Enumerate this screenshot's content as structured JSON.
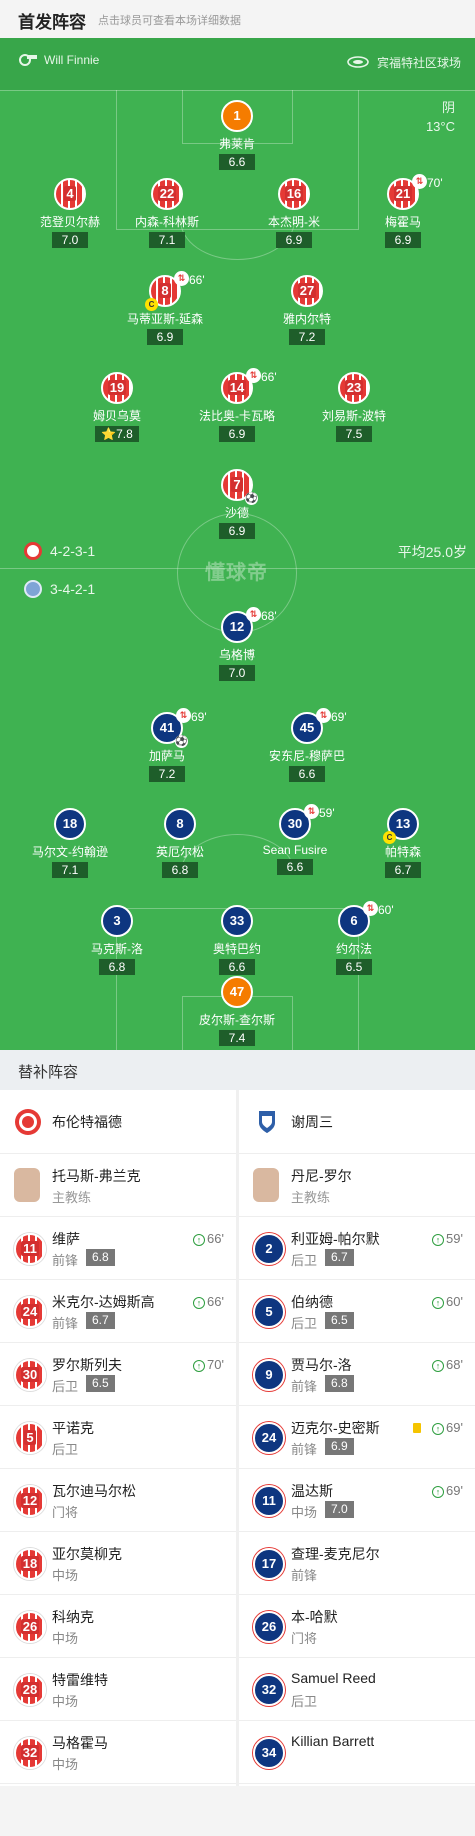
{
  "header": {
    "title": "首发阵容",
    "subtitle": "点击球员可查看本场详细数据"
  },
  "pitch": {
    "referee": "Will Finnie",
    "venue": "宾福特社区球场",
    "weather": "阴",
    "temperature": "13°C",
    "watermark": "懂球帝",
    "home_formation": "4-2-3-1",
    "away_formation": "3-4-2-1",
    "avg_age": "平均25.0岁"
  },
  "home_players": [
    {
      "num": "1",
      "name": "弗莱肯",
      "rating": "6.6"
    },
    {
      "num": "4",
      "name": "范登贝尔赫",
      "rating": "7.0"
    },
    {
      "num": "22",
      "name": "内森-科林斯",
      "rating": "7.1"
    },
    {
      "num": "16",
      "name": "本杰明-米",
      "rating": "6.9"
    },
    {
      "num": "21",
      "name": "梅霍马",
      "rating": "6.9",
      "sub": "70'"
    },
    {
      "num": "8",
      "name": "马蒂亚斯-延森",
      "rating": "6.9",
      "sub": "66'",
      "captain": "C"
    },
    {
      "num": "27",
      "name": "雅内尔特",
      "rating": "7.2"
    },
    {
      "num": "19",
      "name": "姆贝乌莫",
      "rating": "7.8"
    },
    {
      "num": "14",
      "name": "法比奥-卡瓦略",
      "rating": "6.9",
      "sub": "66'"
    },
    {
      "num": "23",
      "name": "刘易斯-波特",
      "rating": "7.5"
    },
    {
      "num": "7",
      "name": "沙德",
      "rating": "6.9",
      "goal": true
    }
  ],
  "away_players": [
    {
      "num": "12",
      "name": "乌格博",
      "rating": "7.0",
      "sub": "68'"
    },
    {
      "num": "41",
      "name": "加萨马",
      "rating": "7.2",
      "sub": "69'",
      "goal": true
    },
    {
      "num": "45",
      "name": "安东尼-穆萨巴",
      "rating": "6.6",
      "sub": "69'"
    },
    {
      "num": "18",
      "name": "马尔文-约翰逊",
      "rating": "7.1"
    },
    {
      "num": "8",
      "name": "英厄尔松",
      "rating": "6.8"
    },
    {
      "num": "30",
      "name": "Sean Fusire",
      "rating": "6.6",
      "sub": "59'"
    },
    {
      "num": "13",
      "name": "帕特森",
      "rating": "6.7",
      "captain": "C"
    },
    {
      "num": "3",
      "name": "马克斯-洛",
      "rating": "6.8"
    },
    {
      "num": "33",
      "name": "奥特巴约",
      "rating": "6.6"
    },
    {
      "num": "6",
      "name": "约尔法",
      "rating": "6.5",
      "sub": "60'"
    },
    {
      "num": "47",
      "name": "皮尔斯-查尔斯",
      "rating": "7.4"
    }
  ],
  "subs": {
    "title": "替补阵容",
    "home": {
      "team": "布伦特福德",
      "coach": {
        "name": "托马斯-弗兰克",
        "role": "主教练"
      },
      "players": [
        {
          "num": "11",
          "name": "维萨",
          "pos": "前锋",
          "rating": "6.8",
          "in": "66'"
        },
        {
          "num": "24",
          "name": "米克尔-达姆斯高",
          "pos": "前锋",
          "rating": "6.7",
          "in": "66'"
        },
        {
          "num": "30",
          "name": "罗尔斯列夫",
          "pos": "后卫",
          "rating": "6.5",
          "in": "70'"
        },
        {
          "num": "5",
          "name": "平诺克",
          "pos": "后卫"
        },
        {
          "num": "12",
          "name": "瓦尔迪马尔松",
          "pos": "门将"
        },
        {
          "num": "18",
          "name": "亚尔莫柳克",
          "pos": "中场"
        },
        {
          "num": "26",
          "name": "科纳克",
          "pos": "中场"
        },
        {
          "num": "28",
          "name": "特雷维特",
          "pos": "中场"
        },
        {
          "num": "32",
          "name": "马格霍马",
          "pos": "中场"
        }
      ]
    },
    "away": {
      "team": "谢周三",
      "coach": {
        "name": "丹尼-罗尔",
        "role": "主教练"
      },
      "players": [
        {
          "num": "2",
          "name": "利亚姆-帕尔默",
          "pos": "后卫",
          "rating": "6.7",
          "in": "59'"
        },
        {
          "num": "5",
          "name": "伯纳德",
          "pos": "后卫",
          "rating": "6.5",
          "in": "60'"
        },
        {
          "num": "9",
          "name": "贾马尔-洛",
          "pos": "前锋",
          "rating": "6.8",
          "in": "68'"
        },
        {
          "num": "24",
          "name": "迈克尔-史密斯",
          "pos": "前锋",
          "rating": "6.9",
          "in": "69'",
          "yellow": true
        },
        {
          "num": "11",
          "name": "温达斯",
          "pos": "中场",
          "rating": "7.0",
          "in": "69'"
        },
        {
          "num": "17",
          "name": "查理-麦克尼尔",
          "pos": "前锋"
        },
        {
          "num": "26",
          "name": "本-哈默",
          "pos": "门将"
        },
        {
          "num": "32",
          "name": "Samuel Reed",
          "pos": "后卫"
        },
        {
          "num": "34",
          "name": "Killian Barrett",
          "pos": ""
        }
      ]
    }
  },
  "colors": {
    "pitch": "#3fb251",
    "home": "#e53935",
    "away": "#0e3680",
    "gk": "#f57c00"
  }
}
